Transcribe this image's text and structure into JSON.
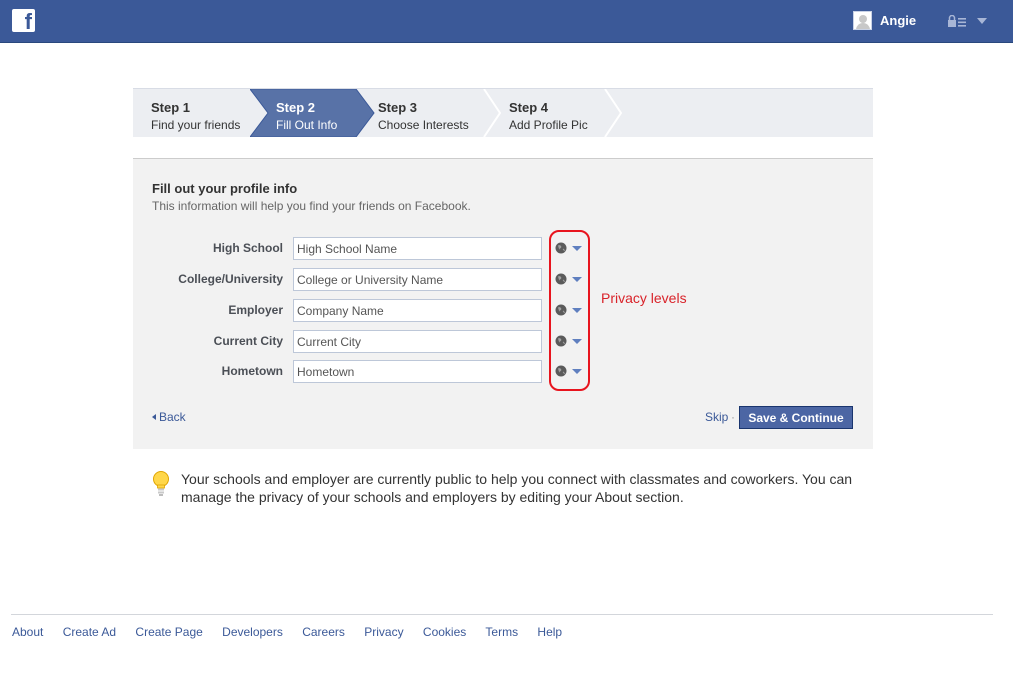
{
  "header": {
    "logo_letter": "f",
    "username": "Angie"
  },
  "steps": [
    {
      "num": "Step 1",
      "label": "Find your friends",
      "active": false
    },
    {
      "num": "Step 2",
      "label": "Fill Out Info",
      "active": true
    },
    {
      "num": "Step 3",
      "label": "Choose Interests",
      "active": false
    },
    {
      "num": "Step 4",
      "label": "Add Profile Pic",
      "active": false
    }
  ],
  "form": {
    "title": "Fill out your profile info",
    "subtitle": "This information will help you find your friends on Facebook.",
    "fields": [
      {
        "label": "High School",
        "placeholder": "High School Name",
        "value": ""
      },
      {
        "label": "College/University",
        "placeholder": "College or University Name",
        "value": ""
      },
      {
        "label": "Employer",
        "placeholder": "Company Name",
        "value": ""
      },
      {
        "label": "Current City",
        "placeholder": "Current City",
        "value": ""
      },
      {
        "label": "Hometown",
        "placeholder": "Hometown",
        "value": ""
      }
    ],
    "privacy_icon": "globe-icon",
    "annotation": "Privacy levels",
    "back_label": "Back",
    "skip_label": "Skip",
    "separator": "·",
    "save_label": "Save & Continue"
  },
  "tip": {
    "icon": "lightbulb-icon",
    "text": "Your schools and employer are currently public to help you connect with classmates and coworkers. You can manage the privacy of your schools and employers by editing your About section."
  },
  "footer": {
    "links": [
      "About",
      "Create Ad",
      "Create Page",
      "Developers",
      "Careers",
      "Privacy",
      "Cookies",
      "Terms",
      "Help"
    ]
  },
  "colors": {
    "brand": "#3b5998",
    "annotation": "#e8141e",
    "button": "#4c66a4"
  }
}
